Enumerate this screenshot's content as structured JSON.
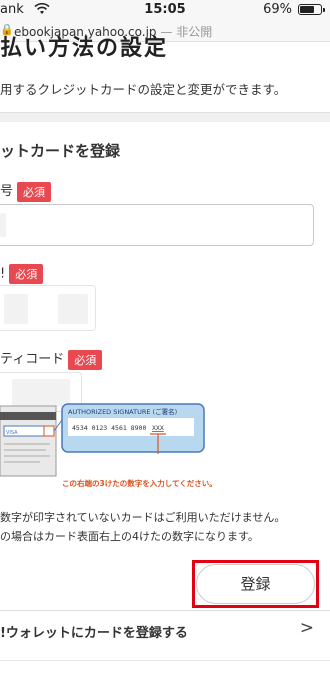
{
  "status_bar": {
    "carrier": "ank",
    "time": "15:05",
    "battery_pct": "69%"
  },
  "url_bar": {
    "host": "ebookjapan.yahoo.co.jp",
    "dash": " — ",
    "privacy": "非公開"
  },
  "page": {
    "title": "払い方法の設定",
    "description": "用するクレジットカードの設定と変更ができます。"
  },
  "form": {
    "section_title": "ットカードを登録",
    "required_label": "必須",
    "card_number_label": "号",
    "expiry_label": "!",
    "security_code_label": "ティコード",
    "card_number_value": "",
    "expiry_value": "",
    "security_code_value": ""
  },
  "cvv_illustration": {
    "signature_heading": "AUTHORIZED SIGNATURE (ご署名)",
    "card_digits": "4534 0123 4561 8900",
    "cvv_digits": "XXX",
    "hint": "この右端の3けたの数字を入力してください。",
    "back_card_text": "VISA"
  },
  "notes": {
    "line1": "数字が印字されていないカードはご利用いただけません。",
    "line2": "の場合はカード表面右上の4けたの数字になります。"
  },
  "register_button": {
    "label": "登録"
  },
  "wallet_link": {
    "label": "!ウォレットにカードを登録する",
    "chevron": ">"
  },
  "colors": {
    "required_badge": "#e8484f",
    "highlight_box": "#e30012",
    "illustration_blue": "#b8d8f0",
    "hint_text": "#d9531e"
  }
}
